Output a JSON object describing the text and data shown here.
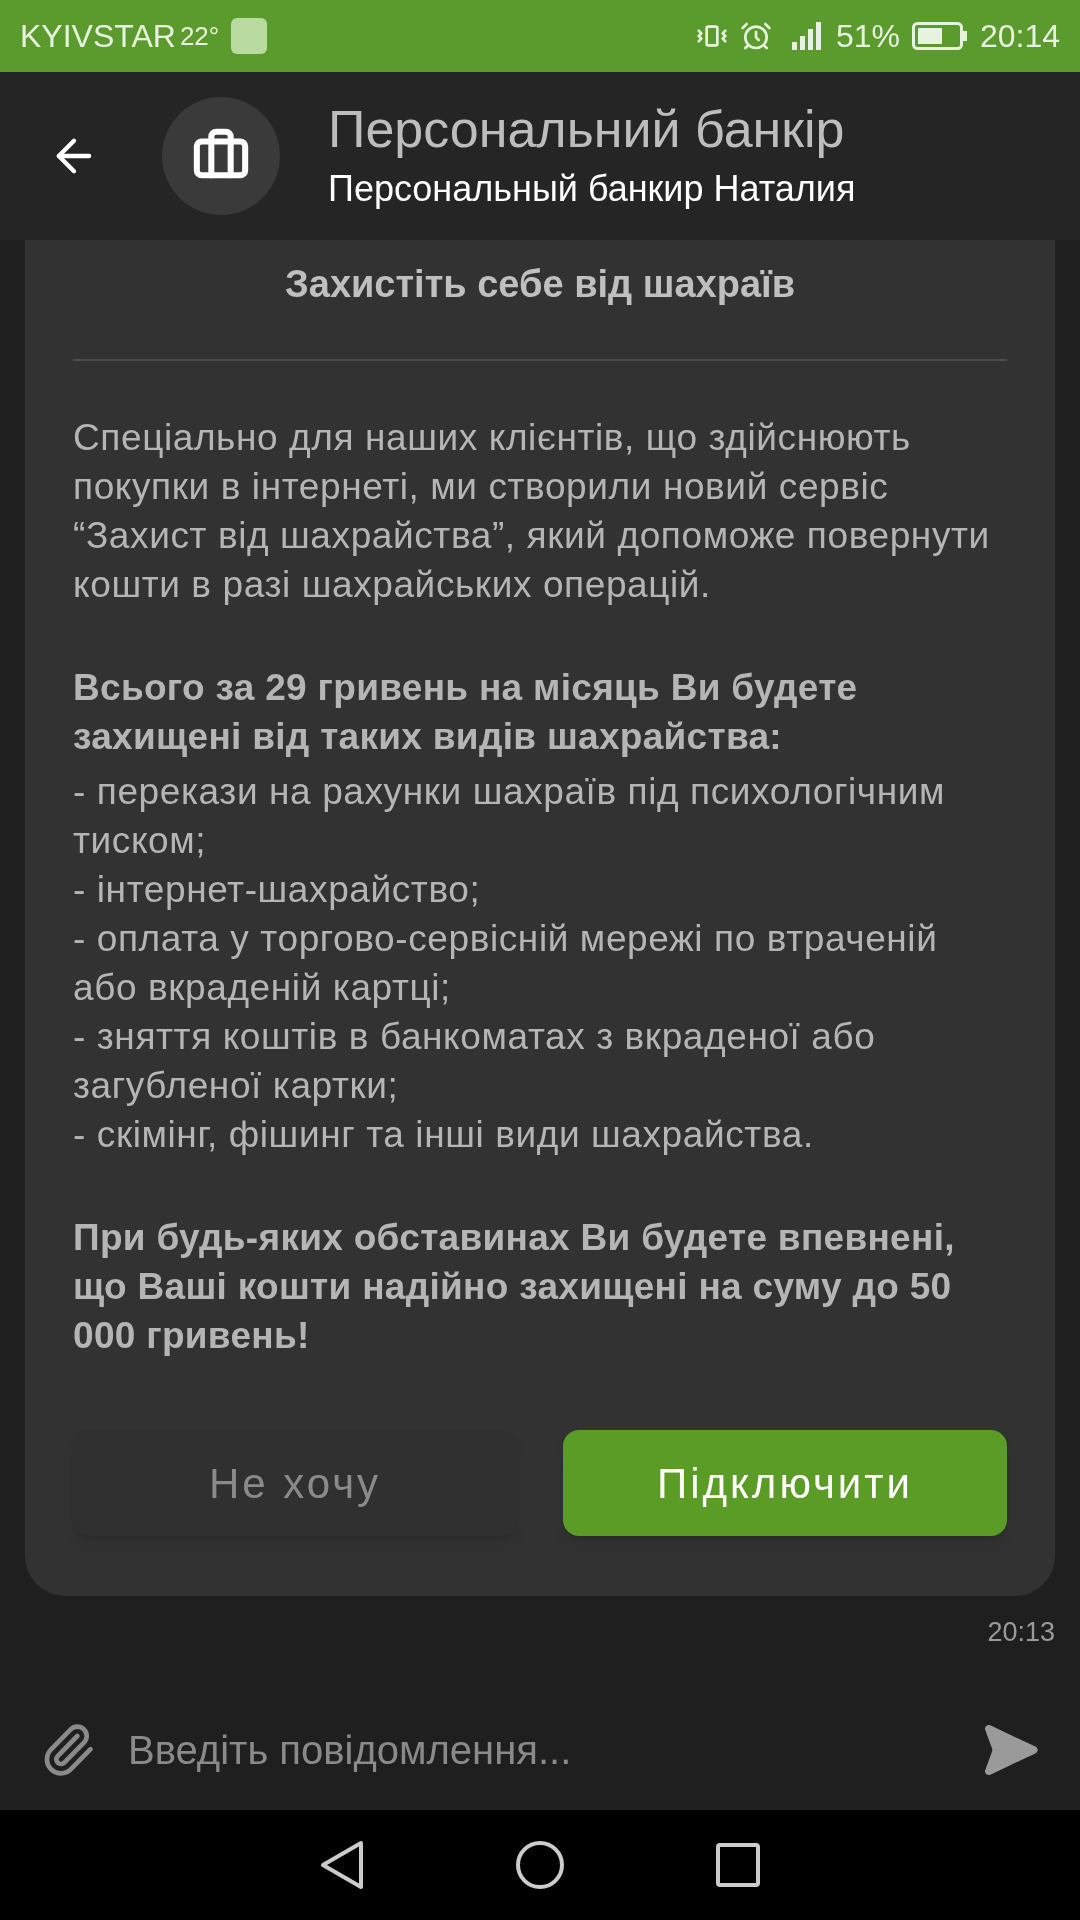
{
  "status_bar": {
    "carrier": "KYIVSTAR",
    "temperature": "22°",
    "battery": "51%",
    "time": "20:14"
  },
  "header": {
    "title": "Персональний банкір",
    "subtitle": "Персональный банкир Наталия"
  },
  "message": {
    "title": "Захистіть себе від шахраїв",
    "intro": "Спеціально для наших клієнтів, що здійснюють покупки в інтернеті, ми створили новий сервіс “Захист від шахрайства”, який допоможе повернути кошти в разі шахрайських операцій.",
    "offer": "Всього за 29 гривень на місяць Ви будете захищені від таких видів шахрайства:",
    "items": [
      "- перекази на рахунки шахраїв під психологічним тиском;",
      "- інтернет-шахрайство;",
      "- оплата у торгово-сервісній мережі по втраченій або вкраденій картці;",
      "- зняття коштів в банкоматах з вкраденої або загубленої картки;",
      "- скімінг, фішинг та інші види шахрайства."
    ],
    "closing": "При будь-яких обставинах Ви будете впевнені, що Ваші кошти надійно захищені на суму до 50 000 гривень!",
    "buttons": [
      {
        "label": "Не хочу",
        "kind": "secondary"
      },
      {
        "label": "Підключити",
        "kind": "primary"
      }
    ],
    "time": "20:13"
  },
  "composer": {
    "placeholder": "Введіть повідомлення..."
  }
}
